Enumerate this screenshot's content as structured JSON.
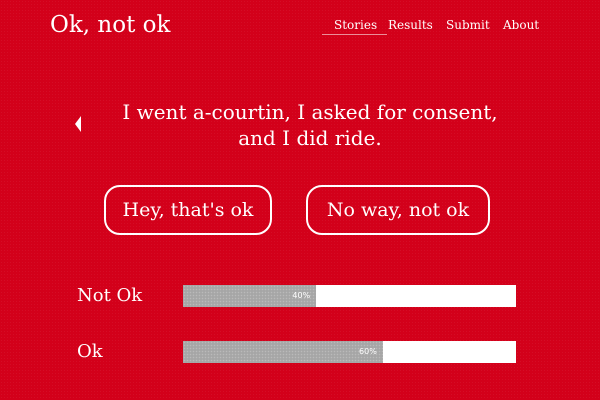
{
  "site": {
    "title": "Ok, not ok"
  },
  "nav": {
    "items": [
      {
        "label": "Stories",
        "active": true
      },
      {
        "label": "Results",
        "active": false
      },
      {
        "label": "Submit",
        "active": false
      },
      {
        "label": "About",
        "active": false
      }
    ]
  },
  "story": {
    "line1": "I went a-courtin, I asked for consent,",
    "line2": "and I did ride."
  },
  "vote": {
    "ok_label": "Hey, that's ok",
    "not_ok_label": "No way, not ok"
  },
  "results": [
    {
      "label": "Not Ok",
      "percent": 40,
      "percent_label": "40%"
    },
    {
      "label": "Ok",
      "percent": 60,
      "percent_label": "60%"
    }
  ],
  "colors": {
    "background": "#d3001a",
    "bar_fill": "#a6a6a6",
    "bar_track": "#ffffff",
    "text": "#ffffff"
  }
}
